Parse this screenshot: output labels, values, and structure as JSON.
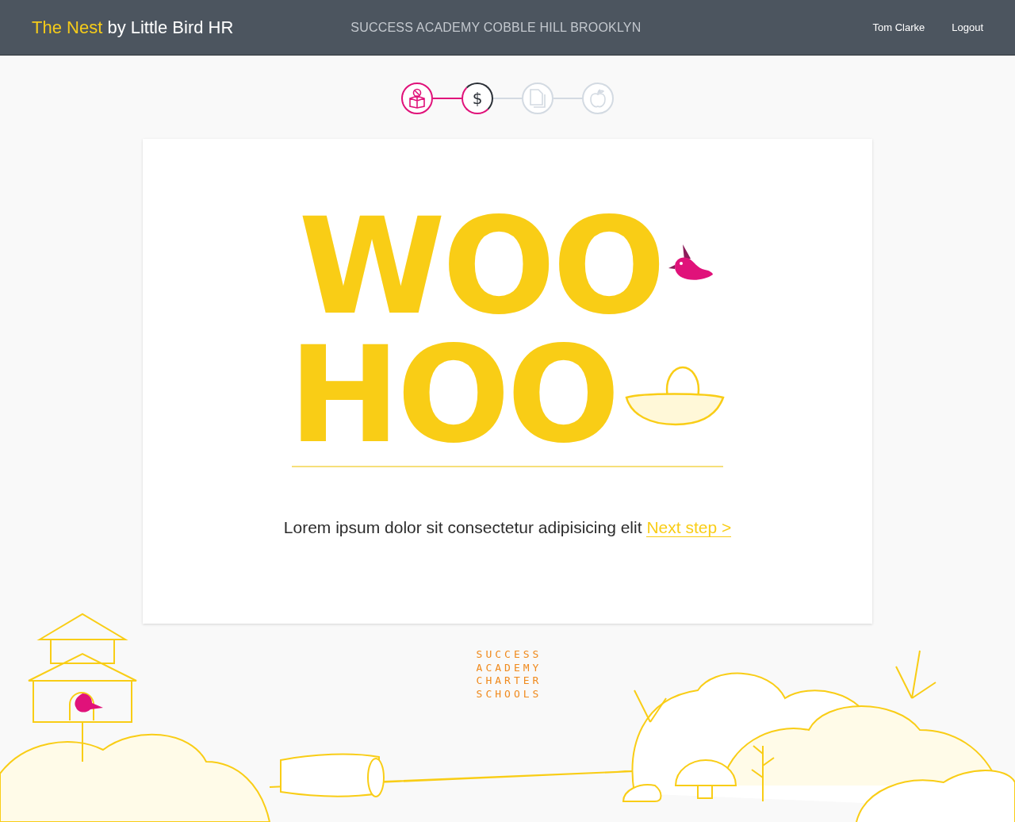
{
  "header": {
    "brand_highlight": "The Nest",
    "brand_rest": "by Little Bird HR",
    "school": "SUCCESS ACADEMY COBBLE HILL BROOKLYN",
    "user": "Tom Clarke",
    "logout": "Logout"
  },
  "steps": [
    {
      "kind": "reader",
      "done": true,
      "selected": false
    },
    {
      "kind": "dollar",
      "symbol": "$",
      "done": false,
      "selected": true
    },
    {
      "kind": "pages",
      "done": false,
      "selected": false
    },
    {
      "kind": "apple",
      "done": false,
      "selected": false
    }
  ],
  "card": {
    "headline": [
      "WOO",
      "HOO"
    ],
    "message": "Lorem ipsum dolor sit consectetur adipisicing elit",
    "link": "Next step >"
  },
  "footer_logo": [
    "SUCCESS",
    "ACADEMY",
    "CHARTER",
    "SCHOOLS"
  ]
}
